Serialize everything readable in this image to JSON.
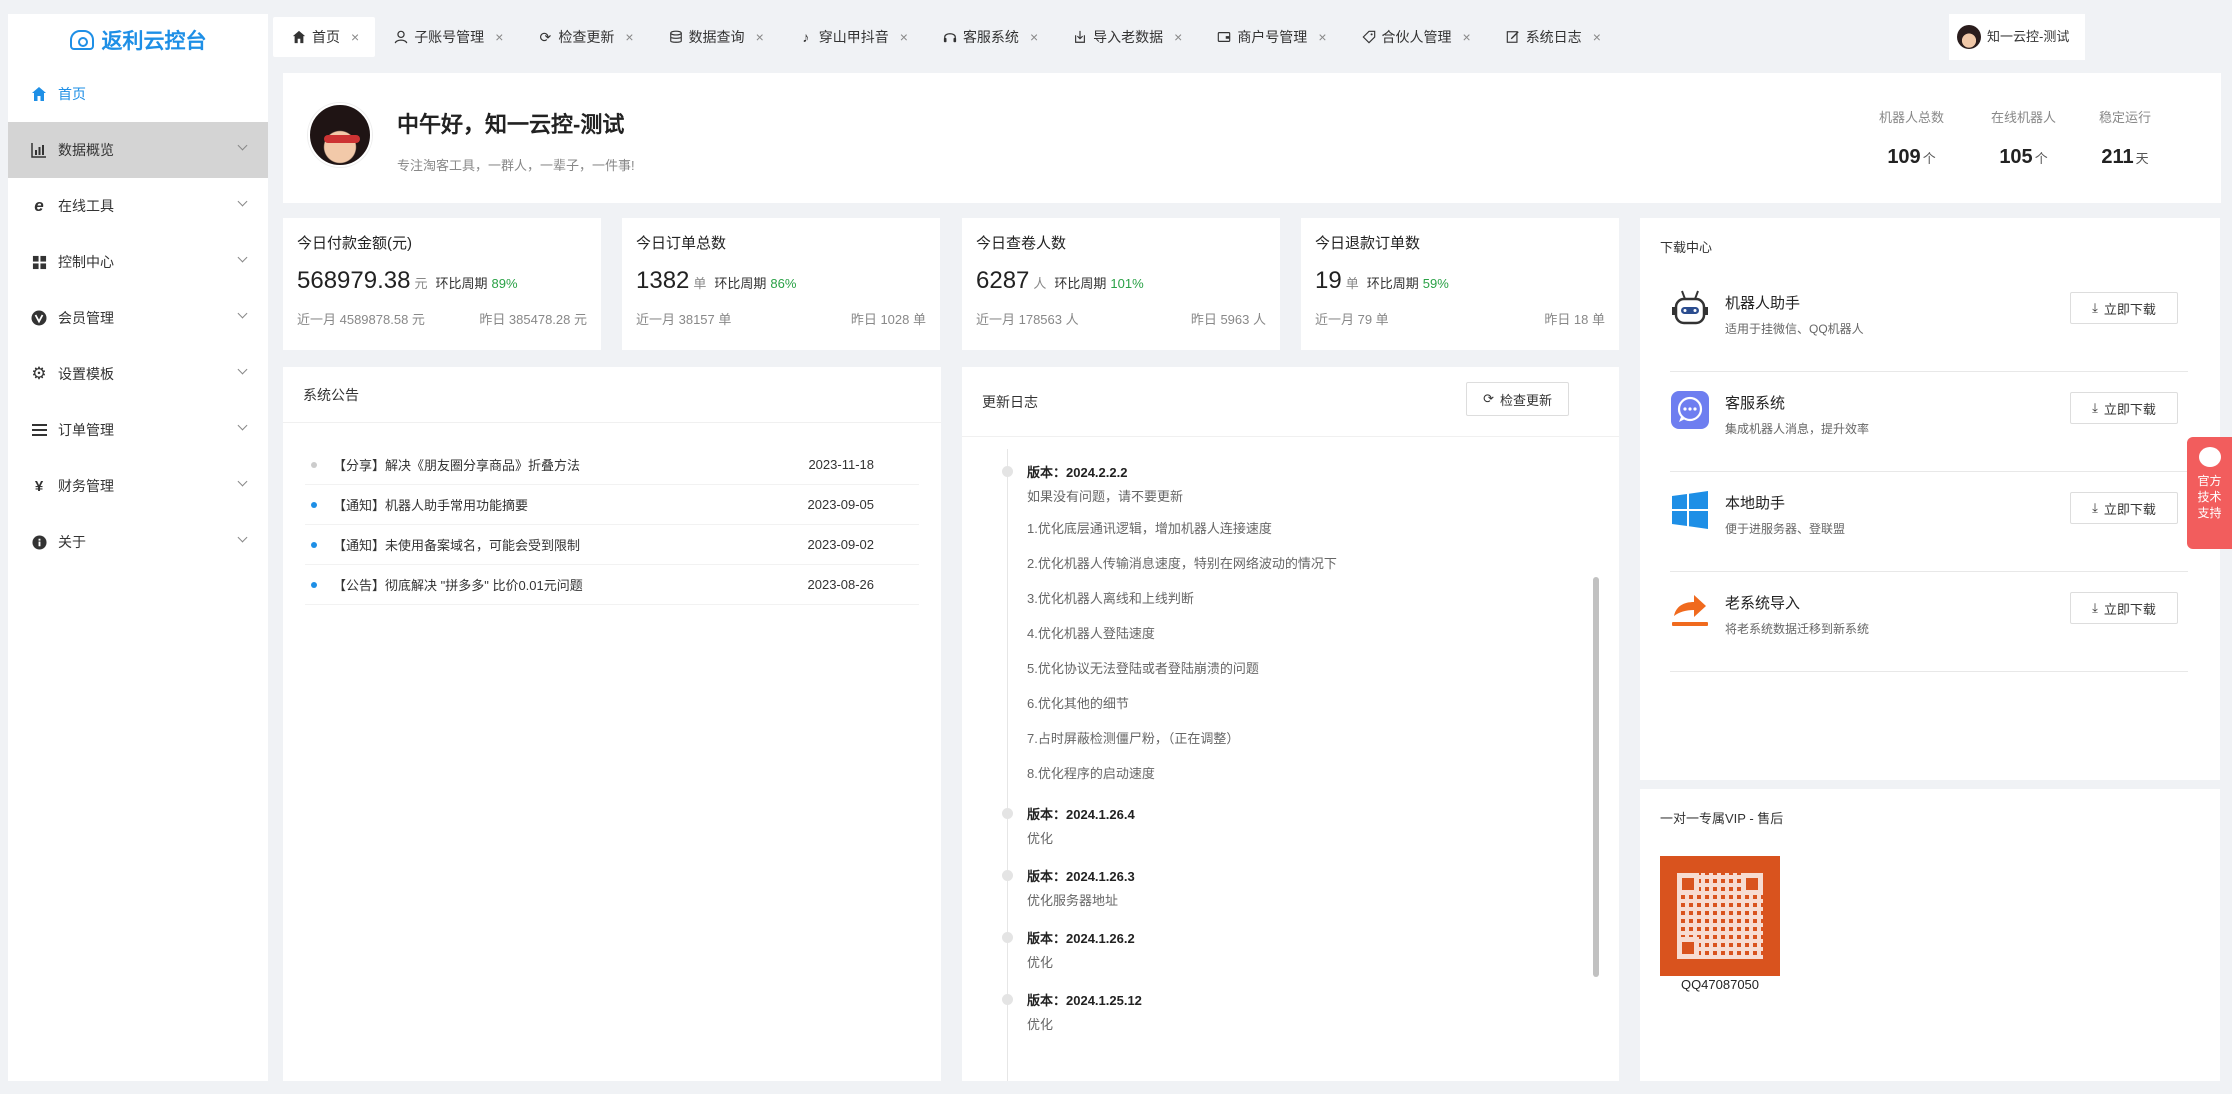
{
  "app": {
    "logo_text": "返利云控台"
  },
  "sidebar": {
    "items": [
      {
        "label": "首页",
        "icon": "home-icon"
      },
      {
        "label": "数据概览",
        "icon": "bar-chart-icon"
      },
      {
        "label": "在线工具",
        "icon": "ie-icon"
      },
      {
        "label": "控制中心",
        "icon": "windows-icon"
      },
      {
        "label": "会员管理",
        "icon": "vip-icon"
      },
      {
        "label": "设置模板",
        "icon": "gear-icon"
      },
      {
        "label": "订单管理",
        "icon": "list-icon"
      },
      {
        "label": "财务管理",
        "icon": "yen-icon"
      },
      {
        "label": "关于",
        "icon": "info-icon"
      }
    ]
  },
  "tabs": [
    {
      "label": "首页",
      "icon": "home-icon",
      "close": "×"
    },
    {
      "label": "子账号管理",
      "icon": "user-icon",
      "close": "×"
    },
    {
      "label": "检查更新",
      "icon": "refresh-icon",
      "close": "×"
    },
    {
      "label": "数据查询",
      "icon": "database-icon",
      "close": "×"
    },
    {
      "label": "穿山甲抖音",
      "icon": "tiktok-icon",
      "close": "×"
    },
    {
      "label": "客服系统",
      "icon": "headset-icon",
      "close": "×"
    },
    {
      "label": "导入老数据",
      "icon": "import-icon",
      "close": "×"
    },
    {
      "label": "商户号管理",
      "icon": "wallet-icon",
      "close": "×"
    },
    {
      "label": "合伙人管理",
      "icon": "tag-icon",
      "close": "×"
    },
    {
      "label": "系统日志",
      "icon": "edit-icon",
      "close": "×"
    }
  ],
  "user": {
    "name": "知一云控-测试"
  },
  "welcome": {
    "greeting": "中午好，知一云控-测试",
    "motto": "专注淘客工具，一群人，一辈子，一件事!",
    "stats": [
      {
        "label": "机器人总数",
        "value": "109",
        "unit": "个"
      },
      {
        "label": "在线机器人",
        "value": "105",
        "unit": "个"
      },
      {
        "label": "稳定运行",
        "value": "211",
        "unit": "天"
      }
    ]
  },
  "kpis": [
    {
      "title": "今日付款金额(元)",
      "value": "568979.38",
      "unit": "元",
      "cycle_label": "环比周期",
      "pct": "89%",
      "month": "近一月 4589878.58 元",
      "yesterday": "昨日 385478.28 元"
    },
    {
      "title": "今日订单总数",
      "value": "1382",
      "unit": "单",
      "cycle_label": "环比周期",
      "pct": "86%",
      "month": "近一月 38157 单",
      "yesterday": "昨日 1028 单"
    },
    {
      "title": "今日查卷人数",
      "value": "6287",
      "unit": "人",
      "cycle_label": "环比周期",
      "pct": "101%",
      "month": "近一月 178563 人",
      "yesterday": "昨日 5963 人"
    },
    {
      "title": "今日退款订单数",
      "value": "19",
      "unit": "单",
      "cycle_label": "环比周期",
      "pct": "59%",
      "month": "近一月 79 单",
      "yesterday": "昨日 18 单"
    }
  ],
  "notice": {
    "title": "系统公告",
    "items": [
      {
        "text": "【分享】解决《朋友圈分享商品》折叠方法",
        "date": "2023-11-18"
      },
      {
        "text": "【通知】机器人助手常用功能摘要",
        "date": "2023-09-05"
      },
      {
        "text": "【通知】未使用备案域名，可能会受到限制",
        "date": "2023-09-02"
      },
      {
        "text": "【公告】彻底解决 \"拼多多\" 比价0.01元问题",
        "date": "2023-08-26"
      }
    ]
  },
  "changelog": {
    "title": "更新日志",
    "check_button": "检查更新",
    "entries": [
      {
        "version": "版本：2024.2.2.2",
        "lines": [
          "如果没有问题，请不要更新",
          "1.优化底层通讯逻辑，增加机器人连接速度",
          "2.优化机器人传输消息速度，特别在网络波动的情况下",
          "3.优化机器人离线和上线判断",
          "4.优化机器人登陆速度",
          "5.优化协议无法登陆或者登陆崩溃的问题",
          "6.优化其他的细节",
          "7.占时屏蔽检测僵尸粉，（正在调整）",
          "8.优化程序的启动速度"
        ]
      },
      {
        "version": "版本：2024.1.26.4",
        "lines": [
          "优化"
        ]
      },
      {
        "version": "版本：2024.1.26.3",
        "lines": [
          "优化服务器地址"
        ]
      },
      {
        "version": "版本：2024.1.26.2",
        "lines": [
          "优化"
        ]
      },
      {
        "version": "版本：2024.1.25.12",
        "lines": [
          "优化"
        ]
      }
    ]
  },
  "download": {
    "title": "下载中心",
    "button_label": "立即下载",
    "items": [
      {
        "name": "机器人助手",
        "desc": "适用于挂微信、QQ机器人",
        "icon": "robot-icon"
      },
      {
        "name": "客服系统",
        "desc": "集成机器人消息，提升效率",
        "icon": "chat-icon"
      },
      {
        "name": "本地助手",
        "desc": "便于进服务器、登联盟",
        "icon": "windows-icon"
      },
      {
        "name": "老系统导入",
        "desc": "将老系统数据迁移到新系统",
        "icon": "share-arrow-icon"
      }
    ]
  },
  "vip": {
    "title": "一对一专属VIP - 售后",
    "qq": "QQ47087050"
  },
  "support": {
    "label": "官方技术支持"
  },
  "colors": {
    "accent": "#1e8fe6",
    "positive": "#2aa146",
    "support": "#f25d5d"
  }
}
